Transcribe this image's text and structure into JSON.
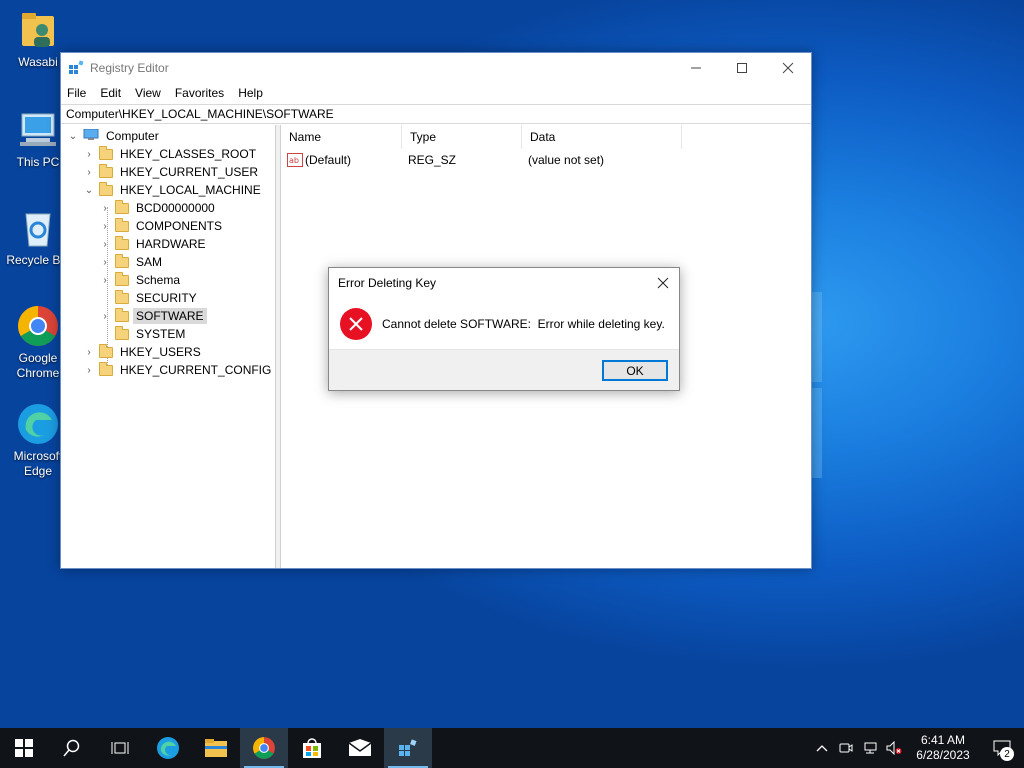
{
  "desktop": {
    "icons": [
      {
        "label": "Wasabi",
        "icon": "user-folder-icon"
      },
      {
        "label": "This PC",
        "icon": "computer-icon"
      },
      {
        "label": "Recycle Bin",
        "icon": "recycle-bin-icon"
      },
      {
        "label": "Google Chrome",
        "icon": "chrome-icon"
      },
      {
        "label": "Microsoft Edge",
        "icon": "edge-icon"
      }
    ]
  },
  "regedit": {
    "title": "Registry Editor",
    "menu": [
      "File",
      "Edit",
      "View",
      "Favorites",
      "Help"
    ],
    "address": "Computer\\HKEY_LOCAL_MACHINE\\SOFTWARE",
    "tree": {
      "root": "Computer",
      "hives": [
        "HKEY_CLASSES_ROOT",
        "HKEY_CURRENT_USER",
        "HKEY_LOCAL_MACHINE",
        "HKEY_USERS",
        "HKEY_CURRENT_CONFIG"
      ],
      "hklm_children": [
        "BCD00000000",
        "COMPONENTS",
        "HARDWARE",
        "SAM",
        "Schema",
        "SECURITY",
        "SOFTWARE",
        "SYSTEM"
      ],
      "selected": "SOFTWARE"
    },
    "columns": [
      "Name",
      "Type",
      "Data"
    ],
    "values": [
      {
        "name": "(Default)",
        "type": "REG_SZ",
        "data": "(value not set)",
        "icon": "string-value-icon"
      }
    ]
  },
  "dialog": {
    "title": "Error Deleting Key",
    "message": "Cannot delete SOFTWARE:  Error while deleting key.",
    "ok_label": "OK",
    "icon": "error-icon"
  },
  "taskbar": {
    "apps": [
      "start-icon",
      "search-icon",
      "task-view-icon",
      "edge-icon",
      "file-explorer-icon",
      "chrome-icon",
      "store-icon",
      "mail-icon",
      "regedit-icon"
    ],
    "clock": {
      "time": "6:41 AM",
      "date": "6/28/2023"
    },
    "notification_count": "2"
  },
  "colors": {
    "accent": "#0078d7",
    "error": "#e81123",
    "taskbar": "#101418"
  }
}
